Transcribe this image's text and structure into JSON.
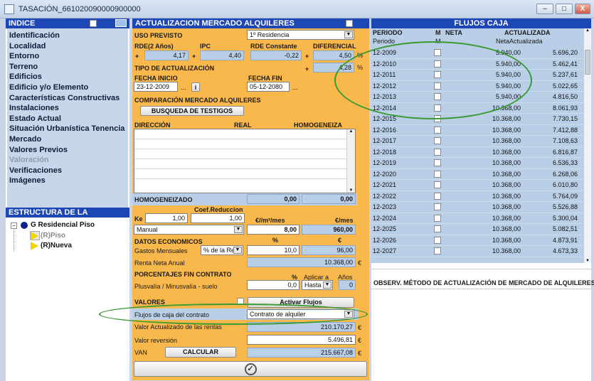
{
  "window": {
    "title": "TASACIÓN_661020090000900000",
    "btn_min": "–",
    "btn_max": "□",
    "btn_close": "X"
  },
  "indice": {
    "header": "INDICE",
    "items": [
      {
        "label": "Identificación",
        "enabled": true
      },
      {
        "label": "Localidad",
        "enabled": true
      },
      {
        "label": "Entorno",
        "enabled": true
      },
      {
        "label": "Terreno",
        "enabled": true
      },
      {
        "label": "Edificios",
        "enabled": true
      },
      {
        "label": "Edificio y/o Elemento",
        "enabled": true
      },
      {
        "label": "Características Constructivas",
        "enabled": true
      },
      {
        "label": "Instalaciones",
        "enabled": true
      },
      {
        "label": "Estado Actual",
        "enabled": true
      },
      {
        "label": "Situación Urbanística Tenencia",
        "enabled": true
      },
      {
        "label": "Mercado",
        "enabled": true
      },
      {
        "label": "Valores Previos",
        "enabled": true
      },
      {
        "label": "Valoración",
        "enabled": false
      },
      {
        "label": "Verificaciones",
        "enabled": true
      },
      {
        "label": "Imágenes",
        "enabled": true
      }
    ]
  },
  "estructura": {
    "header": "ESTRUCTURA DE LA TASACION",
    "root": "G Residencial Piso",
    "children": [
      "(R)Piso",
      "(R)Nueva"
    ]
  },
  "actualizacion": {
    "header": "ACTUALIZACION MERCADO ALQUILERES",
    "uso_previsto_label": "USO PREVISTO",
    "uso_previsto_value": "1º Residencia",
    "rde_label": "RDE(2 Años)",
    "rde_value": "4,17",
    "ipc_label": "IPC",
    "ipc_value": "4,40",
    "rde_const_label": "RDE Constante",
    "rde_const_value": "-0,22",
    "diferencial_label": "DIFERENCIAL",
    "diferencial_value": "4,50",
    "tipo_label": "TIPO DE ACTUALIZACIÓN",
    "tipo_value": "4,28",
    "pct": "%",
    "plus": "+",
    "fecha_inicio_label": "FECHA INICIO",
    "fecha_inicio_value": "23-12-2009",
    "fecha_fin_label": "FECHA FIN",
    "fecha_fin_value": "05-12-2080",
    "ellipsis": "...",
    "info_btn": "i",
    "comparacion_label": "COMPARACIÓN MERCADO ALQUILERES",
    "busqueda_btn": "BUSQUEDA DE TESTIGOS",
    "col_direccion": "DIRECCIÓN",
    "col_real": "REAL",
    "col_homogeneiza": "HOMOGENEIZA",
    "homogeneizado_label": "HOMOGENEIZADO",
    "homog_val1": "0,00",
    "homog_val2": "0,00",
    "coef_label": "Coef.Reduccion",
    "ke_label": "Ke",
    "ke_value": "1,00",
    "coef_value": "1,00",
    "eur_m2_label": "€//m²/mes",
    "eur_mes_label": "€/mes",
    "manual_value": "Manual",
    "eur_m2_value": "8,00",
    "eur_mes_value": "960,00",
    "datos_label": "DATOS ECONOMICOS",
    "pct_hdr": "%",
    "eur_hdr": "€",
    "gastos_label": "Gastos Mensuales",
    "gastos_sel": "% de la Re",
    "gastos_pct": "10,0",
    "gastos_eur": "96,00",
    "renta_label": "Renta Neta Anual",
    "renta_value": "10.368,00",
    "eur_sym": "€",
    "porc_label": "PORCENTAJES FIN CONTRATO",
    "aplicar_label": "Aplicar a",
    "anos_label": "Años",
    "plusvalia_label": "Plusvalía / Minusvalía - suelo",
    "plusvalia_value": "0,0",
    "aplicar_value": "Hasta fi",
    "anos_value": "0",
    "valores_label": "VALORES",
    "activar_btn": "Activar Flujos",
    "flujos_label": "Flujos de caja del contrato",
    "flujos_value": "Contrato de alquiler",
    "valor_act_label": "Valor Actualizado de las rentas",
    "valor_act_value": "210.170,27",
    "valor_rev_label": "Valor reversión",
    "valor_rev_value": "5.496,81",
    "van_label": "VAN",
    "calcular_btn": "CALCULAR",
    "van_value": "215.667,08"
  },
  "flujos": {
    "header": "FLUJOS CAJA",
    "col_periodo": "PERIODO",
    "col_m": "M",
    "col_neta": "NETA",
    "col_act": "ACTUALIZADA",
    "sub_periodo": "Periodo",
    "sub_m": "M",
    "sub_neta": "NetaActualizada",
    "rows": [
      {
        "periodo": "12-2009",
        "neta": "5.940,00",
        "act": "5.696,20"
      },
      {
        "periodo": "12-2010",
        "neta": "5.940,00",
        "act": "5.462,41"
      },
      {
        "periodo": "12-2011",
        "neta": "5.940,00",
        "act": "5.237,61"
      },
      {
        "periodo": "12-2012",
        "neta": "5.940,00",
        "act": "5.022,65"
      },
      {
        "periodo": "12-2013",
        "neta": "5.940,00",
        "act": "4.816,50"
      },
      {
        "periodo": "12-2014",
        "neta": "10.368,00",
        "act": "8.061,93"
      },
      {
        "periodo": "12-2015",
        "neta": "10.368,00",
        "act": "7.730,15"
      },
      {
        "periodo": "12-2016",
        "neta": "10.368,00",
        "act": "7.412,88"
      },
      {
        "periodo": "12-2017",
        "neta": "10.368,00",
        "act": "7.108,63"
      },
      {
        "periodo": "12-2018",
        "neta": "10.368,00",
        "act": "6.816,87"
      },
      {
        "periodo": "12-2019",
        "neta": "10.368,00",
        "act": "6.536,33"
      },
      {
        "periodo": "12-2020",
        "neta": "10.368,00",
        "act": "6.268,06"
      },
      {
        "periodo": "12-2021",
        "neta": "10.368,00",
        "act": "6.010,80"
      },
      {
        "periodo": "12-2022",
        "neta": "10.368,00",
        "act": "5.764,09"
      },
      {
        "periodo": "12-2023",
        "neta": "10.368,00",
        "act": "5.526,88"
      },
      {
        "periodo": "12-2024",
        "neta": "10.368,00",
        "act": "5.300,04"
      },
      {
        "periodo": "12-2025",
        "neta": "10.368,00",
        "act": "5.082,51"
      },
      {
        "periodo": "12-2026",
        "neta": "10.368,00",
        "act": "4.873,91"
      },
      {
        "periodo": "12-2027",
        "neta": "10.368,00",
        "act": "4.673,33"
      }
    ],
    "observ_label": "OBSERV. MÉTODO DE ACTUALIZACIÓN DE MERCADO DE ALQUILERES"
  },
  "colors": {
    "header_blue": "#1d47b4",
    "panel_orange": "#f9b84b",
    "grid_blue": "#b9cee7",
    "highlight_green": "#3a9a34"
  }
}
